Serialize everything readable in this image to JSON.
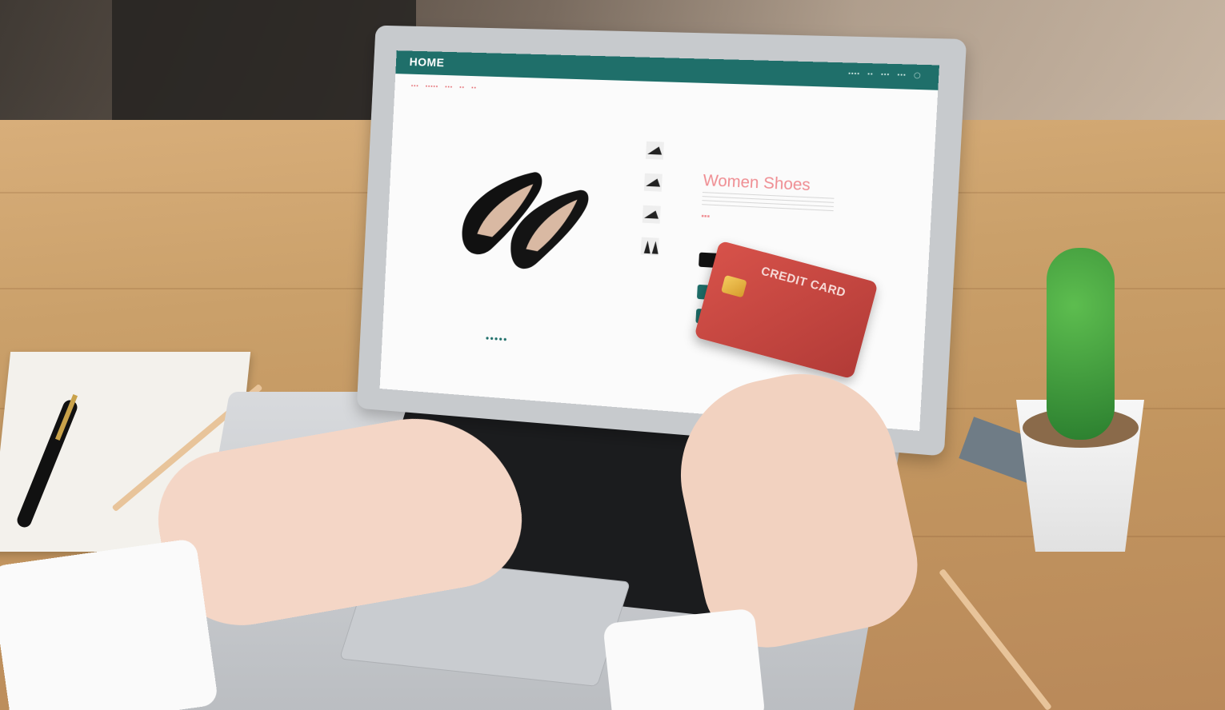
{
  "screen_ui": {
    "top_nav": {
      "home_label": "HOME"
    },
    "product": {
      "title": "Women Shoes"
    }
  },
  "credit_card": {
    "label": "CREDIT CARD"
  },
  "colors": {
    "nav_teal": "#1f6f6a",
    "accent_pink": "#ef8d92",
    "card_red": "#c8463f"
  }
}
